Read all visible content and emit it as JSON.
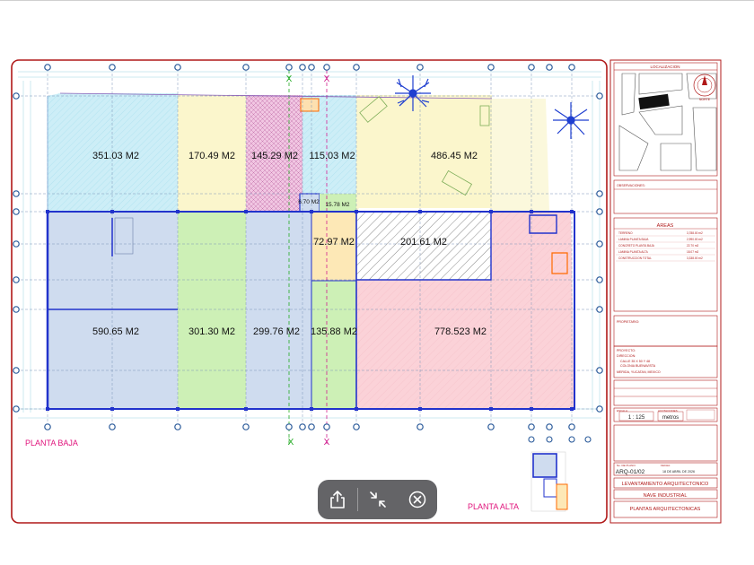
{
  "drawing": {
    "ground_floor_label": "PLANTA BAJA",
    "upper_floor_label": "PLANTA  ALTA",
    "axis_marker_x": "X",
    "areas": {
      "a1": "351.03 M2",
      "a2": "170.49 M2",
      "a3": "145.29 M2",
      "a4": "115.03 M2",
      "a5": "486.45 M2",
      "a6": "6.70 M2",
      "a7": "15.78 M2",
      "a8": "72.97 M2",
      "a9": "201.61 M2",
      "a10": "590.65 M2",
      "a11": "301.30 M2",
      "a12": "299.76 M2",
      "a13": "135.88 M2",
      "a14": "778.523 M2"
    },
    "colors": {
      "cyan_zone": "#cdeef7",
      "yellow_zone": "#fbf6cc",
      "magenta_zone": "#f1c6e2",
      "blue_zone": "#cfdcef",
      "green_zone": "#cdf0b6",
      "orange_zone": "#fde8b6",
      "pink_zone": "#fbd2d8",
      "wall_blue": "#2233cc",
      "label_magenta": "#e0147c",
      "sheet_border": "#b01818"
    }
  },
  "title_block": {
    "location_heading": "LOCALIZACION",
    "north_label": "NORTE",
    "notes_heading": "OBSERVACIONES:",
    "areas_heading": "AREAS",
    "area_rows": [
      {
        "label": "TERRENO",
        "value": "3,788.00 m2"
      },
      {
        "label": "LAMINA PLANTA BAJA",
        "value": "2,990.00 m2"
      },
      {
        "label": "CONCRETO PLANTA BAJA",
        "value": "22.70 m2"
      },
      {
        "label": "LAMINA PLANTA ALTA",
        "value": "18.07 m2"
      },
      {
        "label": "CONSTRUCCION TOTAL",
        "value": "3,338.00 m2"
      }
    ],
    "owner_label": "PROPIETARIO:",
    "project_label": "PROYECTO:",
    "address_label": "DIRECCION:",
    "address_line1": "CALLE 35 X 50 Y 48",
    "address_line2": "COLONIA BUENAVISTA",
    "city": "MERIDA, YUCATAN, MEXICO",
    "scale_label": "ESCALA:",
    "scale_value": "1 : 125",
    "units_label": "ACOTACIONES:",
    "units_value": "metros",
    "plan_no_label": "No. DE PLANO:",
    "plan_no": "ARQ-01/02",
    "date_label": "FECHA:",
    "date": "18 DE ABRIL DE 2026",
    "doc_title": "LEVANTAMIENTO ARQUITECTONICO",
    "building": "NAVE INDUSTRIAL",
    "sheet_subject": "PLANTAS ARQUITECTONICAS"
  },
  "toolbar": {
    "share_icon": "share-icon",
    "collapse_icon": "collapse-icon",
    "close_icon": "close-circle-icon"
  }
}
